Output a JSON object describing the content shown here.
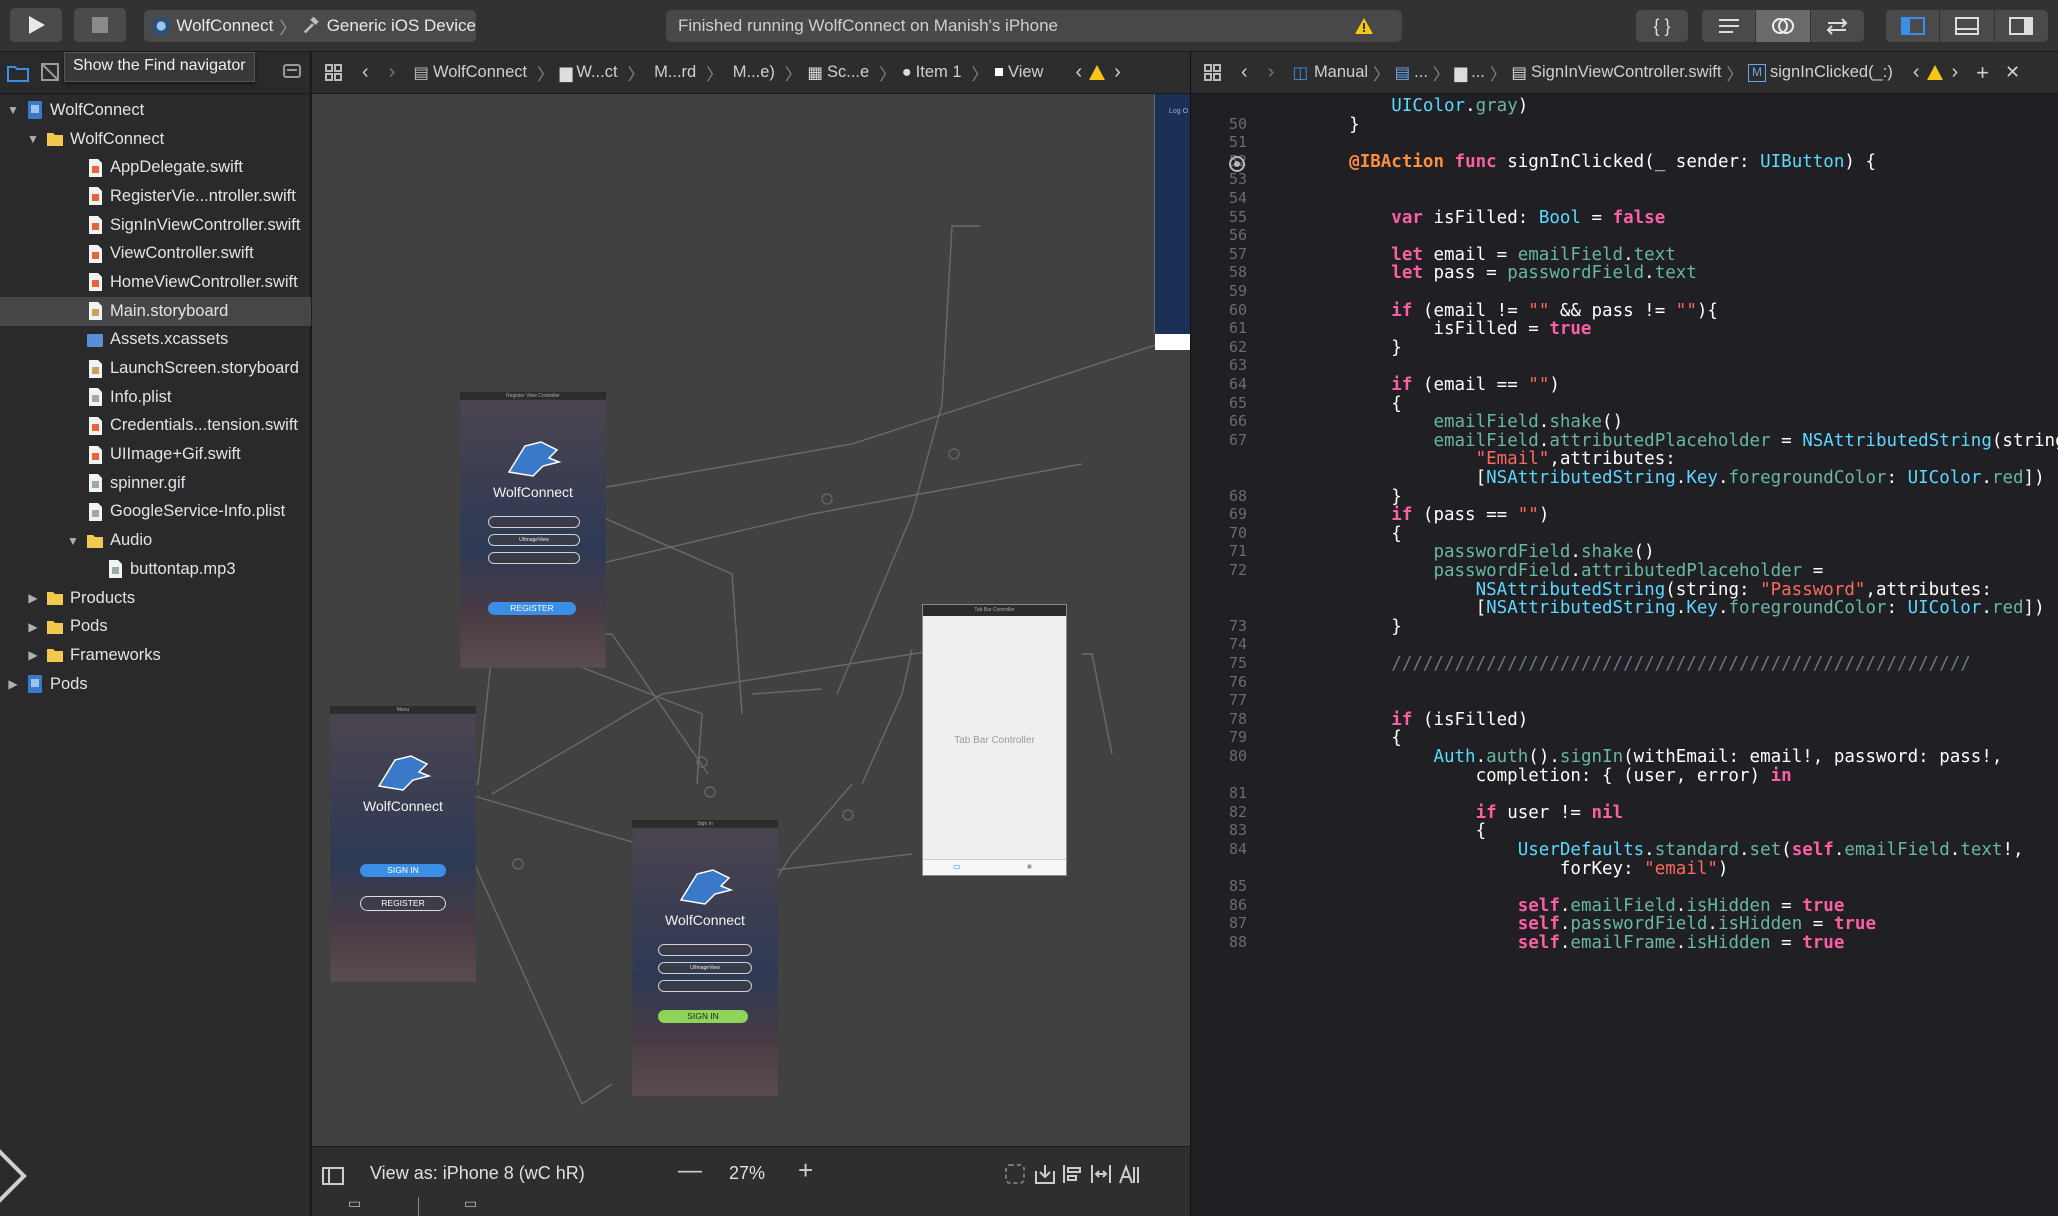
{
  "toolbar": {
    "scheme_project": "WolfConnect",
    "scheme_device": "Generic iOS Device",
    "status_text": "Finished running WolfConnect on Manish's iPhone"
  },
  "navigator": {
    "tooltip": "Show the Find navigator",
    "items": [
      {
        "label": "WolfConnect",
        "level": 0,
        "kind": "project",
        "disclosure": "open"
      },
      {
        "label": "WolfConnect",
        "level": 1,
        "kind": "folder",
        "disclosure": "open"
      },
      {
        "label": "AppDelegate.swift",
        "level": 2,
        "kind": "swift"
      },
      {
        "label": "RegisterVie...ntroller.swift",
        "level": 2,
        "kind": "swift"
      },
      {
        "label": "SignInViewController.swift",
        "level": 2,
        "kind": "swift"
      },
      {
        "label": "ViewController.swift",
        "level": 2,
        "kind": "swift"
      },
      {
        "label": "HomeViewController.swift",
        "level": 2,
        "kind": "swift"
      },
      {
        "label": "Main.storyboard",
        "level": 2,
        "kind": "storyboard",
        "selected": true
      },
      {
        "label": "Assets.xcassets",
        "level": 2,
        "kind": "assets"
      },
      {
        "label": "LaunchScreen.storyboard",
        "level": 2,
        "kind": "storyboard"
      },
      {
        "label": "Info.plist",
        "level": 2,
        "kind": "plist"
      },
      {
        "label": "Credentials...tension.swift",
        "level": 2,
        "kind": "swift"
      },
      {
        "label": "UIImage+Gif.swift",
        "level": 2,
        "kind": "swift"
      },
      {
        "label": "spinner.gif",
        "level": 2,
        "kind": "image"
      },
      {
        "label": "GoogleService-Info.plist",
        "level": 2,
        "kind": "plist"
      },
      {
        "label": "Audio",
        "level": 2,
        "kind": "folder",
        "disclosure": "open"
      },
      {
        "label": "buttontap.mp3",
        "level": 3,
        "kind": "audio"
      },
      {
        "label": "Products",
        "level": 1,
        "kind": "folder",
        "disclosure": "closed"
      },
      {
        "label": "Pods",
        "level": 1,
        "kind": "folder",
        "disclosure": "closed"
      },
      {
        "label": "Frameworks",
        "level": 1,
        "kind": "folder",
        "disclosure": "closed"
      },
      {
        "label": "Pods",
        "level": 0,
        "kind": "project",
        "disclosure": "closed"
      }
    ]
  },
  "canvas": {
    "jump_bar": [
      "WolfConnect",
      "W...ct",
      "M...rd",
      "M...e)",
      "Sc...e",
      "Item 1",
      "View"
    ],
    "view_as": "View as: iPhone 8 (wC hR)",
    "zoom": "27%",
    "scenes": {
      "register": {
        "title": "Register View Controller",
        "app_name": "WolfConnect",
        "field": "UIImageView",
        "button": "REGISTER"
      },
      "menu": {
        "title": "Menu",
        "app_name": "WolfConnect",
        "sign_in": "SIGN IN",
        "register": "REGISTER"
      },
      "signin": {
        "title": "Sign In",
        "app_name": "WolfConnect",
        "field": "UIImageView",
        "button": "SIGN IN"
      },
      "tabbar": {
        "title": "Tab Bar Controller",
        "label": "Tab Bar Controller"
      },
      "login_partial": "Log O"
    }
  },
  "editor": {
    "jump_bar": [
      "Manual",
      "...",
      "...",
      "SignInViewController.swift",
      "signInClicked(_:)"
    ],
    "method_badge": "M",
    "lines": [
      {
        "n": "",
        "html_key": 0
      },
      {
        "n": "50"
      },
      {
        "n": "51"
      },
      {
        "n": "52"
      },
      {
        "n": "53"
      },
      {
        "n": "54"
      },
      {
        "n": "55"
      },
      {
        "n": "56"
      },
      {
        "n": "57"
      },
      {
        "n": "58"
      },
      {
        "n": "59"
      },
      {
        "n": "60"
      },
      {
        "n": "61"
      },
      {
        "n": "62"
      },
      {
        "n": "63"
      },
      {
        "n": "64"
      },
      {
        "n": "65"
      },
      {
        "n": "66"
      },
      {
        "n": "67"
      },
      {
        "n": ""
      },
      {
        "n": ""
      },
      {
        "n": "68"
      },
      {
        "n": "69"
      },
      {
        "n": "70"
      },
      {
        "n": "71"
      },
      {
        "n": "72"
      },
      {
        "n": ""
      },
      {
        "n": ""
      },
      {
        "n": "73"
      },
      {
        "n": "74"
      },
      {
        "n": "75"
      },
      {
        "n": "76"
      },
      {
        "n": "77"
      },
      {
        "n": "78"
      },
      {
        "n": "79"
      },
      {
        "n": "80"
      },
      {
        "n": ""
      },
      {
        "n": "81"
      },
      {
        "n": "82"
      },
      {
        "n": "83"
      },
      {
        "n": "84"
      },
      {
        "n": ""
      },
      {
        "n": "85"
      },
      {
        "n": "86"
      },
      {
        "n": "87"
      },
      {
        "n": "88"
      }
    ],
    "code": [
      [
        [
          "",
          "        "
        ],
        [
          "ty",
          "UIColor"
        ],
        [
          "",
          "."
        ],
        [
          "pr",
          "gray"
        ],
        [
          "",
          ")"
        ]
      ],
      [
        [
          "",
          "    }"
        ]
      ],
      [],
      [
        [
          "",
          "    "
        ],
        [
          "at",
          "@IBAction"
        ],
        [
          "",
          " "
        ],
        [
          "kw",
          "func"
        ],
        [
          "",
          " signInClicked(_ sender: "
        ],
        [
          "ty",
          "UIButton"
        ],
        [
          "",
          ") {"
        ]
      ],
      [],
      [],
      [
        [
          "",
          "        "
        ],
        [
          "kw",
          "var"
        ],
        [
          "",
          " isFilled: "
        ],
        [
          "ty",
          "Bool"
        ],
        [
          "",
          " = "
        ],
        [
          "kw",
          "false"
        ]
      ],
      [],
      [
        [
          "",
          "        "
        ],
        [
          "kw",
          "let"
        ],
        [
          "",
          " email = "
        ],
        [
          "pr",
          "emailField"
        ],
        [
          "",
          "."
        ],
        [
          "pr",
          "text"
        ]
      ],
      [
        [
          "",
          "        "
        ],
        [
          "kw",
          "let"
        ],
        [
          "",
          " pass = "
        ],
        [
          "pr",
          "passwordField"
        ],
        [
          "",
          "."
        ],
        [
          "pr",
          "text"
        ]
      ],
      [],
      [
        [
          "",
          "        "
        ],
        [
          "kw",
          "if"
        ],
        [
          "",
          " (email != "
        ],
        [
          "st",
          "\"\""
        ],
        [
          "",
          " && pass != "
        ],
        [
          "st",
          "\"\""
        ],
        [
          "",
          "){"
        ]
      ],
      [
        [
          "",
          "            isFilled = "
        ],
        [
          "kw",
          "true"
        ]
      ],
      [
        [
          "",
          "        }"
        ]
      ],
      [],
      [
        [
          "",
          "        "
        ],
        [
          "kw",
          "if"
        ],
        [
          "",
          " (email == "
        ],
        [
          "st",
          "\"\""
        ],
        [
          "",
          ")"
        ]
      ],
      [
        [
          "",
          "        {"
        ]
      ],
      [
        [
          "",
          "            "
        ],
        [
          "pr",
          "emailField"
        ],
        [
          "",
          "."
        ],
        [
          "pr",
          "shake"
        ],
        [
          "",
          "()"
        ]
      ],
      [
        [
          "",
          "            "
        ],
        [
          "pr",
          "emailField"
        ],
        [
          "",
          "."
        ],
        [
          "pr",
          "attributedPlaceholder"
        ],
        [
          "",
          " = "
        ],
        [
          "ty",
          "NSAttributedString"
        ],
        [
          "",
          "(string:"
        ]
      ],
      [
        [
          "",
          "                "
        ],
        [
          "st",
          "\"Email\""
        ],
        [
          "",
          ",attributes:"
        ]
      ],
      [
        [
          "",
          "                ["
        ],
        [
          "ty",
          "NSAttributedString"
        ],
        [
          "",
          "."
        ],
        [
          "ty",
          "Key"
        ],
        [
          "",
          "."
        ],
        [
          "pr",
          "foregroundColor"
        ],
        [
          "",
          ": "
        ],
        [
          "ty",
          "UIColor"
        ],
        [
          "",
          "."
        ],
        [
          "pr",
          "red"
        ],
        [
          "",
          "])"
        ]
      ],
      [
        [
          "",
          "        }"
        ]
      ],
      [
        [
          "",
          "        "
        ],
        [
          "kw",
          "if"
        ],
        [
          "",
          " (pass == "
        ],
        [
          "st",
          "\"\""
        ],
        [
          "",
          ")"
        ]
      ],
      [
        [
          "",
          "        {"
        ]
      ],
      [
        [
          "",
          "            "
        ],
        [
          "pr",
          "passwordField"
        ],
        [
          "",
          "."
        ],
        [
          "pr",
          "shake"
        ],
        [
          "",
          "()"
        ]
      ],
      [
        [
          "",
          "            "
        ],
        [
          "pr",
          "passwordField"
        ],
        [
          "",
          "."
        ],
        [
          "pr",
          "attributedPlaceholder"
        ],
        [
          "",
          " ="
        ]
      ],
      [
        [
          "",
          "                "
        ],
        [
          "ty",
          "NSAttributedString"
        ],
        [
          "",
          "(string: "
        ],
        [
          "st",
          "\"Password\""
        ],
        [
          "",
          ",attributes:"
        ]
      ],
      [
        [
          "",
          "                ["
        ],
        [
          "ty",
          "NSAttributedString"
        ],
        [
          "",
          "."
        ],
        [
          "ty",
          "Key"
        ],
        [
          "",
          "."
        ],
        [
          "pr",
          "foregroundColor"
        ],
        [
          "",
          ": "
        ],
        [
          "ty",
          "UIColor"
        ],
        [
          "",
          "."
        ],
        [
          "pr",
          "red"
        ],
        [
          "",
          "])"
        ]
      ],
      [
        [
          "",
          "        }"
        ]
      ],
      [],
      [
        [
          "cm",
          "        ///////////////////////////////////////////////////////"
        ]
      ],
      [],
      [],
      [
        [
          "",
          "        "
        ],
        [
          "kw",
          "if"
        ],
        [
          "",
          " (isFilled)"
        ]
      ],
      [
        [
          "",
          "        {"
        ]
      ],
      [
        [
          "",
          "            "
        ],
        [
          "ty",
          "Auth"
        ],
        [
          "",
          "."
        ],
        [
          "pr",
          "auth"
        ],
        [
          "",
          "()."
        ],
        [
          "pr",
          "signIn"
        ],
        [
          "",
          "(withEmail: email!, password: pass!,"
        ]
      ],
      [
        [
          "",
          "                completion: { (user, error) "
        ],
        [
          "kw",
          "in"
        ]
      ],
      [],
      [
        [
          "",
          "                "
        ],
        [
          "kw",
          "if"
        ],
        [
          "",
          " user != "
        ],
        [
          "kw",
          "nil"
        ]
      ],
      [
        [
          "",
          "                {"
        ]
      ],
      [
        [
          "",
          "                    "
        ],
        [
          "ty",
          "UserDefaults"
        ],
        [
          "",
          "."
        ],
        [
          "pr",
          "standard"
        ],
        [
          "",
          "."
        ],
        [
          "pr",
          "set"
        ],
        [
          "",
          "("
        ],
        [
          "kw",
          "self"
        ],
        [
          "",
          "."
        ],
        [
          "pr",
          "emailField"
        ],
        [
          "",
          "."
        ],
        [
          "pr",
          "text"
        ],
        [
          "",
          "!,"
        ]
      ],
      [
        [
          "",
          "                        forKey: "
        ],
        [
          "st",
          "\"email\""
        ],
        [
          "",
          ")"
        ]
      ],
      [],
      [
        [
          "",
          "                    "
        ],
        [
          "kw",
          "self"
        ],
        [
          "",
          "."
        ],
        [
          "pr",
          "emailField"
        ],
        [
          "",
          "."
        ],
        [
          "pr",
          "isHidden"
        ],
        [
          "",
          " = "
        ],
        [
          "kw",
          "true"
        ]
      ],
      [
        [
          "",
          "                    "
        ],
        [
          "kw",
          "self"
        ],
        [
          "",
          "."
        ],
        [
          "pr",
          "passwordField"
        ],
        [
          "",
          "."
        ],
        [
          "pr",
          "isHidden"
        ],
        [
          "",
          " = "
        ],
        [
          "kw",
          "true"
        ]
      ],
      [
        [
          "",
          "                    "
        ],
        [
          "kw",
          "self"
        ],
        [
          "",
          "."
        ],
        [
          "pr",
          "emailFrame"
        ],
        [
          "",
          "."
        ],
        [
          "pr",
          "isHidden"
        ],
        [
          "",
          " = "
        ],
        [
          "kw",
          "true"
        ]
      ]
    ]
  },
  "colors": {
    "accent_blue": "#3a8ee6",
    "keyword": "#fc5fa3",
    "type": "#5dd8ff",
    "property": "#67b7a4",
    "string": "#fc6a5d",
    "attribute": "#fd8f3f",
    "warning": "#f5c518",
    "signin_green": "#8fd35b"
  }
}
